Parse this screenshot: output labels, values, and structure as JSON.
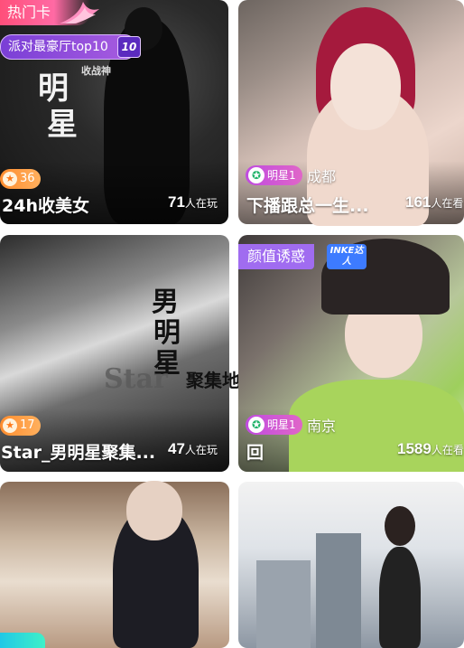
{
  "cards": [
    {
      "hot_label": "热门卡",
      "rank_label": "派对最豪厅top10",
      "rank_num": "10",
      "poster_lines": [
        "明",
        "星"
      ],
      "poster_sub": "收战神",
      "level": "36",
      "title": "24h收美女",
      "viewers": "71",
      "viewers_unit": "人在玩"
    },
    {
      "badge": "明星1",
      "location": "成都",
      "title": "下播跟总一生...",
      "viewers": "161",
      "viewers_unit": "人在看"
    },
    {
      "poster_lines": [
        "男",
        "明",
        "星"
      ],
      "poster_word": "Star",
      "poster_side": "聚集地",
      "level": "17",
      "title": "Star_男明星聚集...",
      "viewers": "47",
      "viewers_unit": "人在玩"
    },
    {
      "tag": "颜值诱惑",
      "tag2": "INKE达人",
      "badge": "明星1",
      "location": "南京",
      "title": "回",
      "viewers": "1589",
      "viewers_unit": "人在看"
    },
    {},
    {}
  ],
  "colors": {
    "hot": "#ff4f7a",
    "rank": "#7a3fd6",
    "level": "#ff8d2e",
    "star_badge": "#c04be0",
    "beauty_tag": "#a06cf0"
  },
  "icons": {
    "level": "level-star-icon",
    "star": "star-badge-icon",
    "flame": "flame-icon"
  }
}
